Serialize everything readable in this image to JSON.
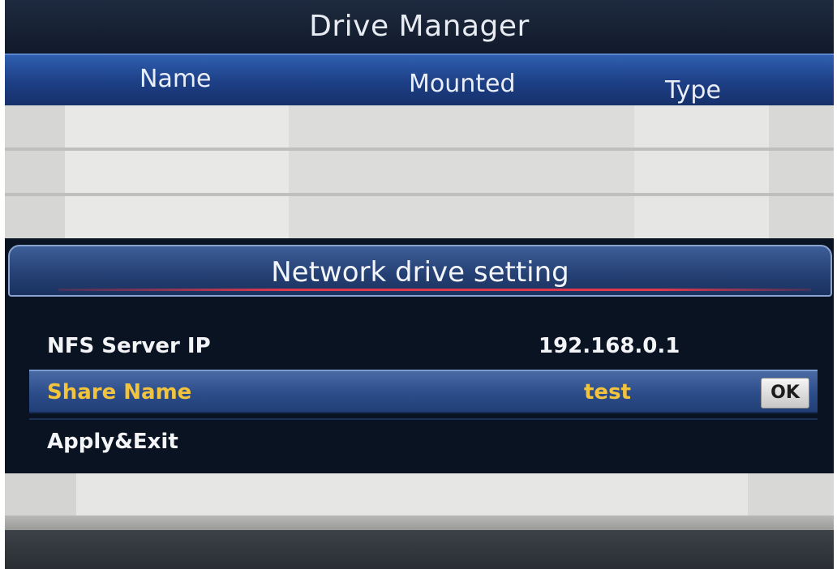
{
  "window": {
    "title": "Drive Manager"
  },
  "table": {
    "columns": [
      "Name",
      "Mounted",
      "Type"
    ],
    "rows": []
  },
  "dialog": {
    "title": "Network drive setting",
    "fields": [
      {
        "label": "NFS Server IP",
        "value": "192.168.0.1"
      },
      {
        "label": "Share Name",
        "value": "test",
        "action": "OK",
        "selected": true
      },
      {
        "label": "Apply&Exit"
      }
    ]
  },
  "colors": {
    "header_blue": "#1d3f85",
    "dialog_bg": "#0a1322",
    "selected_text": "#f2c33d",
    "title_underline": "#e0394d"
  }
}
